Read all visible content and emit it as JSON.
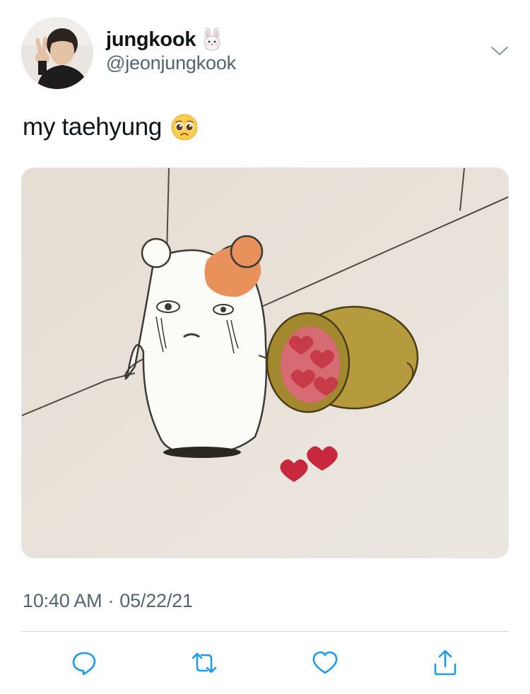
{
  "author": {
    "display_name": "jungkook",
    "display_name_emoji": "rabbit-face-emoji",
    "handle": "@jeonjungkook",
    "avatar": "profile-photo"
  },
  "tweet": {
    "text": "my taehyung",
    "text_emoji": "pleading-face-emoji",
    "media": "hamster-cartoon-spilling-hearts-image",
    "time": "10:40 AM",
    "separator": "·",
    "date": "05/22/21"
  },
  "actions": [
    {
      "name": "reply",
      "icon": "comment-icon"
    },
    {
      "name": "retweet",
      "icon": "retweet-icon"
    },
    {
      "name": "like",
      "icon": "heart-icon"
    },
    {
      "name": "share",
      "icon": "share-icon"
    }
  ],
  "colors": {
    "text_primary": "#0f1419",
    "text_secondary": "#536471",
    "icon": "#1d9bf0",
    "divider": "#cfd9de"
  }
}
